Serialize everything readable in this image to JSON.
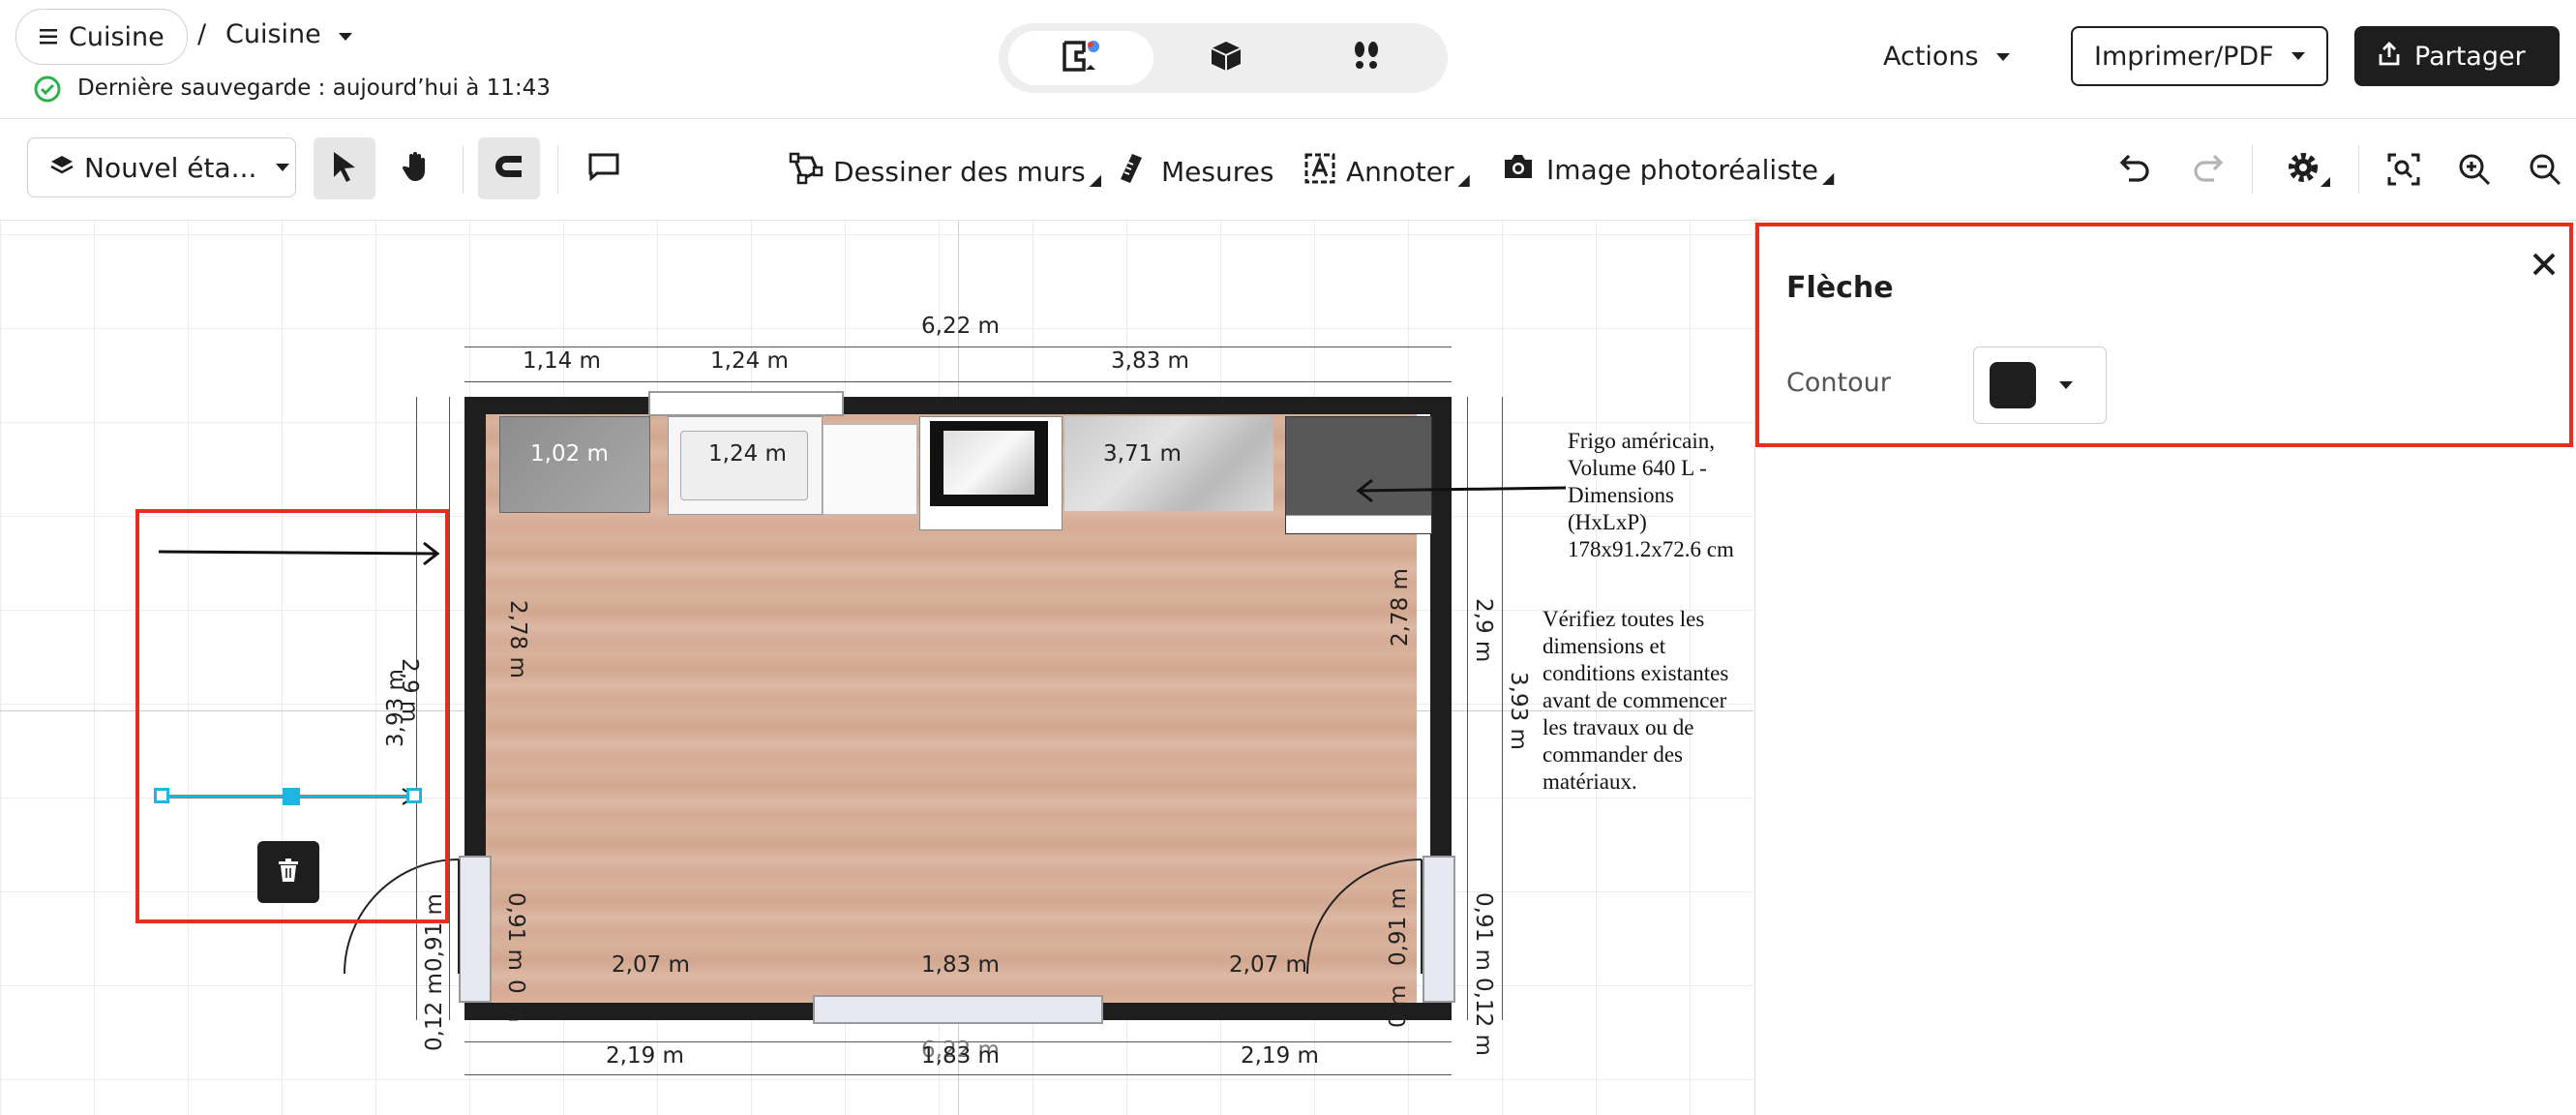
{
  "header": {
    "menu_label": "Cuisine",
    "separator": "/",
    "project_name": "Cuisine",
    "save_status": "Dernière sauvegarde : aujourd’hui à 11:43",
    "actions_label": "Actions",
    "print_label": "Imprimer/PDF",
    "share_label": "Partager"
  },
  "toolbar": {
    "floor_label": "Nouvel éta...",
    "draw_walls": "Dessiner des murs",
    "measures": "Mesures",
    "annotate": "Annoter",
    "photo": "Image photoréaliste"
  },
  "panel": {
    "title": "Flèche",
    "contour_label": "Contour",
    "contour_color": "#1e1e1e"
  },
  "plan": {
    "dims_top": {
      "total": "6,22 m",
      "a": "1,14 m",
      "b": "1,24 m",
      "c": "3,83 m"
    },
    "dims_inner_top": {
      "a": "1,02 m",
      "b": "1,24 m",
      "c": "3,71 m"
    },
    "dims_left": {
      "outer": "3,93 m",
      "mid": "2,9 m",
      "inner": "2,78 m",
      "door": "0,91 m",
      "door_in": "0,91 m",
      "small": "0,12 m",
      "zero": "0 m"
    },
    "dims_right": {
      "outer": "3,93 m",
      "mid": "2,9 m",
      "inner": "2,78 m",
      "door": "0,91 m",
      "door_in": "0,91 m",
      "small": "0,12 m",
      "zero": "0 m"
    },
    "dims_bottom_inner": {
      "a": "2,07 m",
      "b": "1,83 m",
      "c": "2,07 m"
    },
    "dims_bottom": {
      "a": "2,19 m",
      "b": "1,83 m",
      "c": "2,19 m",
      "total": "6,22 m"
    },
    "fridge_note": [
      "Frigo américain,",
      "Volume 640 L -",
      "Dimensions (HxLxP)",
      "178x91.2x72.6 cm"
    ],
    "check_note": [
      "Vérifiez toutes les",
      "dimensions et",
      "conditions existantes",
      "avant de commencer",
      "les travaux ou de",
      "commander des",
      "matériaux."
    ]
  },
  "colors": {
    "accent_red": "#e0301e",
    "selection_blue": "#1fb5e0",
    "wall": "#1e1e1e",
    "floor": "#d9b29c"
  }
}
